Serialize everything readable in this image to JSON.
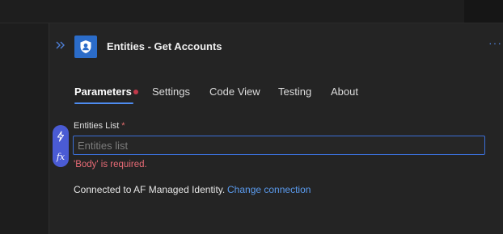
{
  "header": {
    "title": "Entities - Get Accounts",
    "more_label": "···",
    "icon": "shield-person-icon",
    "accent_color": "#2b6cc9"
  },
  "tabs": [
    {
      "label": "Parameters",
      "active": true,
      "has_error_dot": true
    },
    {
      "label": "Settings",
      "active": false
    },
    {
      "label": "Code View",
      "active": false
    },
    {
      "label": "Testing",
      "active": false
    },
    {
      "label": "About",
      "active": false
    }
  ],
  "field": {
    "label": "Entities List",
    "required_mark": "*",
    "placeholder": "Entities list",
    "value": "",
    "error": "'Body' is required."
  },
  "side_buttons": [
    {
      "icon": "lightning-icon",
      "glyph": "ϟ"
    },
    {
      "icon": "function-icon",
      "glyph": "fx"
    }
  ],
  "connection": {
    "text": "Connected to AF Managed Identity.",
    "link_label": "Change connection",
    "link_color": "#5b9cf0"
  },
  "colors": {
    "error": "#e86b76",
    "active_tab_underline": "#4e8cf0",
    "error_dot": "#c0394a"
  }
}
